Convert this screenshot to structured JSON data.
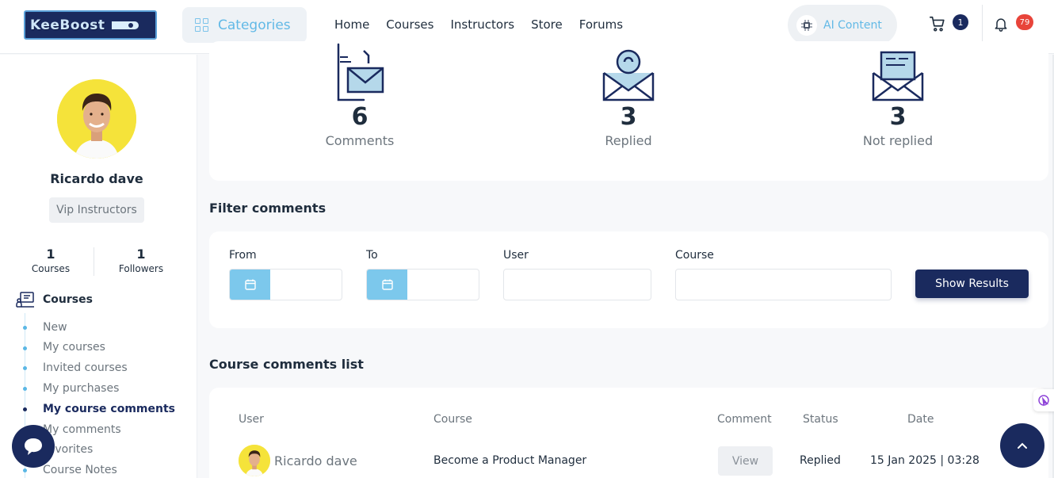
{
  "header": {
    "logo_text": "KeeBoost",
    "categories_label": "Categories",
    "nav": [
      "Home",
      "Courses",
      "Instructors",
      "Store",
      "Forums"
    ],
    "ai_label": "AI Content",
    "cart_count": "1",
    "notification_count": "79"
  },
  "profile": {
    "name": "Ricardo dave",
    "badge": "Vip Instructors",
    "courses_count": "1",
    "courses_label": "Courses",
    "followers_count": "1",
    "followers_label": "Followers"
  },
  "sidebar": {
    "section": "Courses",
    "items": [
      {
        "label": "New",
        "active": false
      },
      {
        "label": "My courses",
        "active": false
      },
      {
        "label": "Invited courses",
        "active": false
      },
      {
        "label": "My purchases",
        "active": false
      },
      {
        "label": "My course comments",
        "active": true
      },
      {
        "label": "My comments",
        "active": false
      },
      {
        "label": "Favorites",
        "active": false
      },
      {
        "label": "Course Notes",
        "active": false
      }
    ]
  },
  "stats": [
    {
      "value": "6",
      "label": "Comments",
      "icon": "envelope-doc-icon"
    },
    {
      "value": "3",
      "label": "Replied",
      "icon": "envelope-reply-icon"
    },
    {
      "value": "3",
      "label": "Not replied",
      "icon": "envelope-letter-icon"
    }
  ],
  "filter": {
    "title": "Filter comments",
    "from_label": "From",
    "to_label": "To",
    "user_label": "User",
    "course_label": "Course",
    "button": "Show Results"
  },
  "list": {
    "title": "Course comments list",
    "headers": {
      "user": "User",
      "course": "Course",
      "comment": "Comment",
      "status": "Status",
      "date": "Date"
    },
    "rows": [
      {
        "user": "Ricardo dave",
        "course": "Become a Product Manager",
        "comment_button": "View",
        "status": "Replied",
        "date": "15 Jan 2025 | 03:28"
      }
    ]
  },
  "colors": {
    "primary": "#1a2a5e",
    "accent": "#62b9e6",
    "badge_red": "#e8443a"
  }
}
